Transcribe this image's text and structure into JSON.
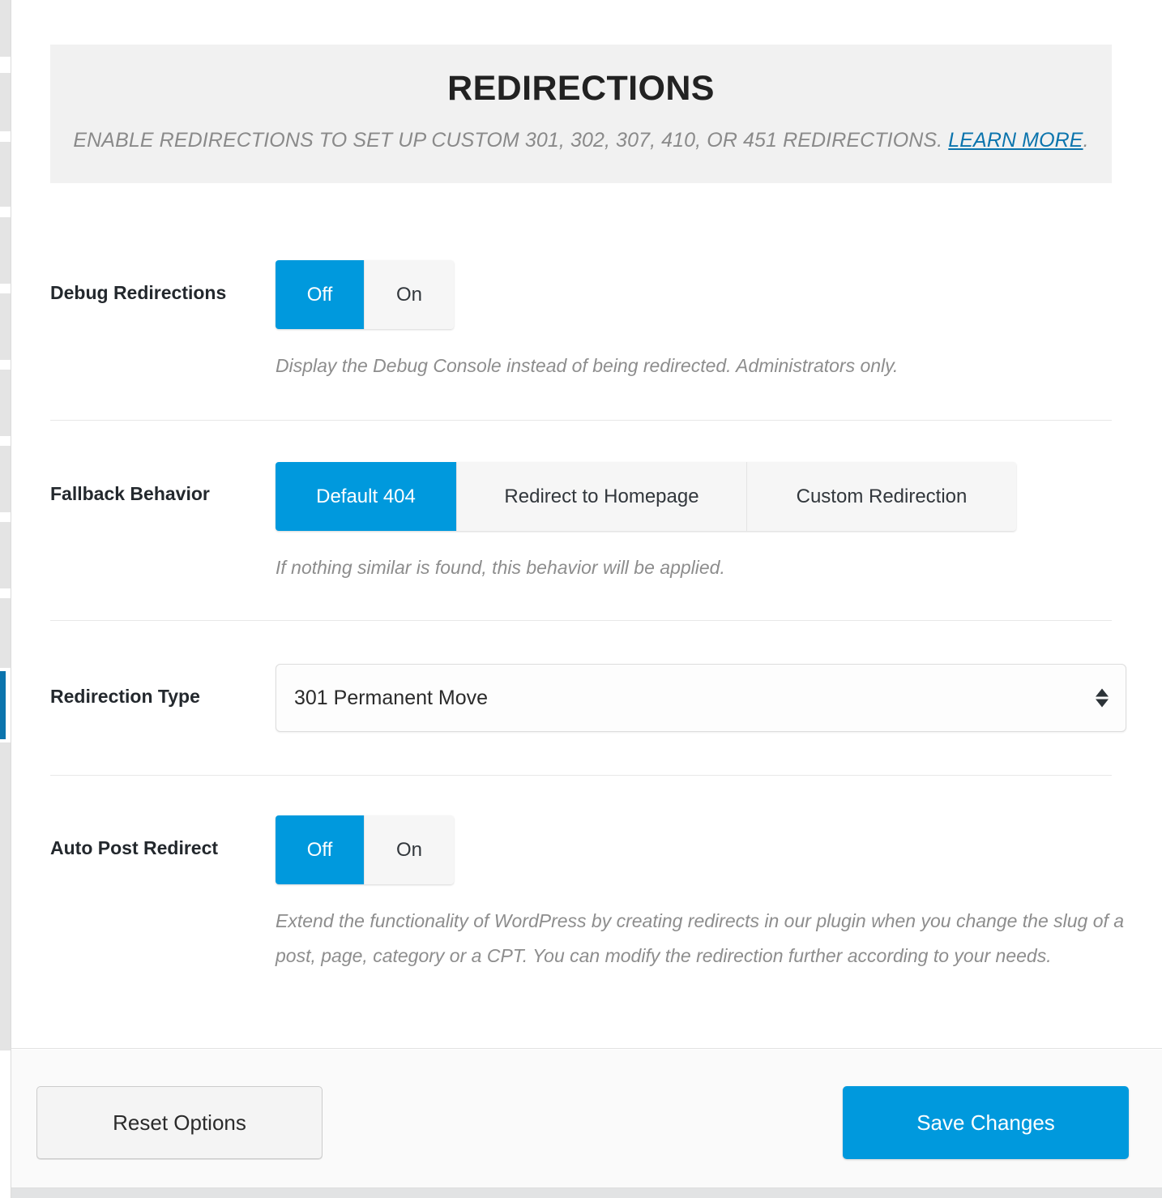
{
  "left_rail": {
    "active_marker_color": "#0b74ad"
  },
  "header": {
    "title": "Redirections",
    "description_before_link": "Enable redirections to set up custom 301, 302, 307, 410, or 451 redirections. ",
    "link_label": "Learn more",
    "description_after_link": "."
  },
  "settings": [
    {
      "label": "Debug Redirections",
      "control": "toggle",
      "options": [
        "Off",
        "On"
      ],
      "selected": "Off",
      "help": "Display the Debug Console instead of being redirected. Administrators only."
    },
    {
      "label": "Fallback Behavior",
      "control": "button-group",
      "options": [
        "Default 404",
        "Redirect to Homepage",
        "Custom Redirection"
      ],
      "selected": "Default 404",
      "help": "If nothing similar is found, this behavior will be applied."
    },
    {
      "label": "Redirection Type",
      "control": "select",
      "selected": "301 Permanent Move",
      "help": ""
    },
    {
      "label": "Auto Post Redirect",
      "control": "toggle",
      "options": [
        "Off",
        "On"
      ],
      "selected": "Off",
      "help": "Extend the functionality of WordPress by creating redirects in our plugin when you change the slug of a post, page, category or a CPT. You can modify the redirection further according to your needs."
    }
  ],
  "footer": {
    "reset_label": "Reset Options",
    "save_label": "Save Changes"
  },
  "colors": {
    "accent": "#0099dd",
    "link": "#0b74ad",
    "banner_bg": "#f1f1f1",
    "footer_bg": "#fafafa"
  }
}
